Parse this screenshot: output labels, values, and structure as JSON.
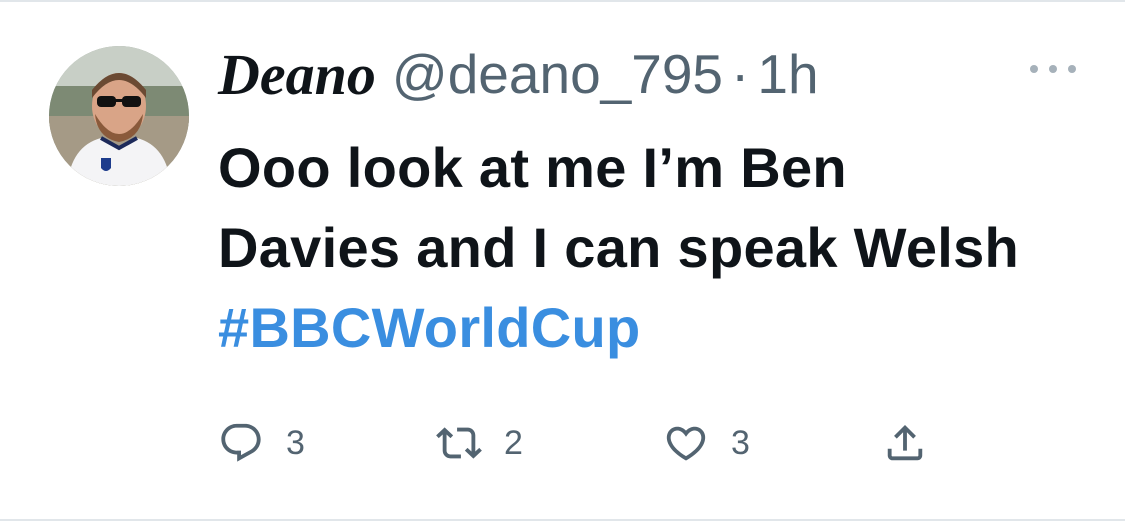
{
  "tweet": {
    "author": {
      "display_name": "Deano",
      "handle": "@deano_795",
      "avatar_icon": "user-avatar-photo"
    },
    "separator": "·",
    "timestamp": "1h",
    "text_before_hashtag": "Ooo look at me I’m Ben Davies and I can speak Welsh ",
    "hashtag": "#BBCWorldCup",
    "hashtag_color": "#3a8ee0",
    "more_icon": "more-horizontal-icon"
  },
  "actions": {
    "reply": {
      "icon": "reply-icon",
      "count": "3"
    },
    "retweet": {
      "icon": "retweet-icon",
      "count": "2"
    },
    "like": {
      "icon": "heart-icon",
      "count": "3"
    },
    "share": {
      "icon": "share-icon"
    }
  },
  "colors": {
    "text": "#0f1419",
    "secondary": "#536471",
    "divider": "#e1e6ea"
  }
}
